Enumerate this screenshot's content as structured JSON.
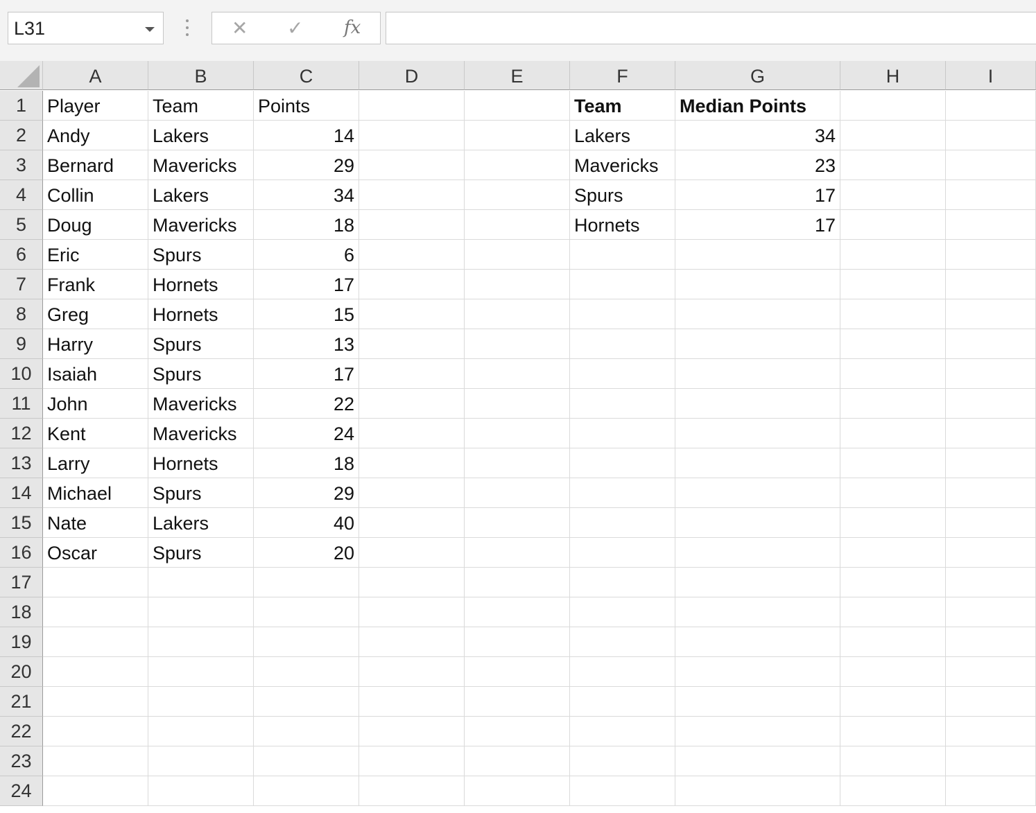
{
  "name_box": "L31",
  "formula_bar": {
    "cancel_glyph": "✕",
    "enter_glyph": "✓",
    "fx_label": "fx",
    "formula_value": ""
  },
  "columns": [
    "A",
    "B",
    "C",
    "D",
    "E",
    "F",
    "G",
    "H",
    "I"
  ],
  "rows": [
    "1",
    "2",
    "3",
    "4",
    "5",
    "6",
    "7",
    "8",
    "9",
    "10",
    "11",
    "12",
    "13",
    "14",
    "15",
    "16",
    "17",
    "18",
    "19",
    "20",
    "21",
    "22",
    "23",
    "24"
  ],
  "table1": {
    "headers": [
      "Player",
      "Team",
      "Points"
    ],
    "rows": [
      [
        "Andy",
        "Lakers",
        "14"
      ],
      [
        "Bernard",
        "Mavericks",
        "29"
      ],
      [
        "Collin",
        "Lakers",
        "34"
      ],
      [
        "Doug",
        "Mavericks",
        "18"
      ],
      [
        "Eric",
        "Spurs",
        "6"
      ],
      [
        "Frank",
        "Hornets",
        "17"
      ],
      [
        "Greg",
        "Hornets",
        "15"
      ],
      [
        "Harry",
        "Spurs",
        "13"
      ],
      [
        "Isaiah",
        "Spurs",
        "17"
      ],
      [
        "John",
        "Mavericks",
        "22"
      ],
      [
        "Kent",
        "Mavericks",
        "24"
      ],
      [
        "Larry",
        "Hornets",
        "18"
      ],
      [
        "Michael",
        "Spurs",
        "29"
      ],
      [
        "Nate",
        "Lakers",
        "40"
      ],
      [
        "Oscar",
        "Spurs",
        "20"
      ]
    ]
  },
  "table2": {
    "headers": [
      "Team",
      "Median Points"
    ],
    "rows": [
      [
        "Lakers",
        "34"
      ],
      [
        "Mavericks",
        "23"
      ],
      [
        "Spurs",
        "17"
      ],
      [
        "Hornets",
        "17"
      ]
    ]
  }
}
